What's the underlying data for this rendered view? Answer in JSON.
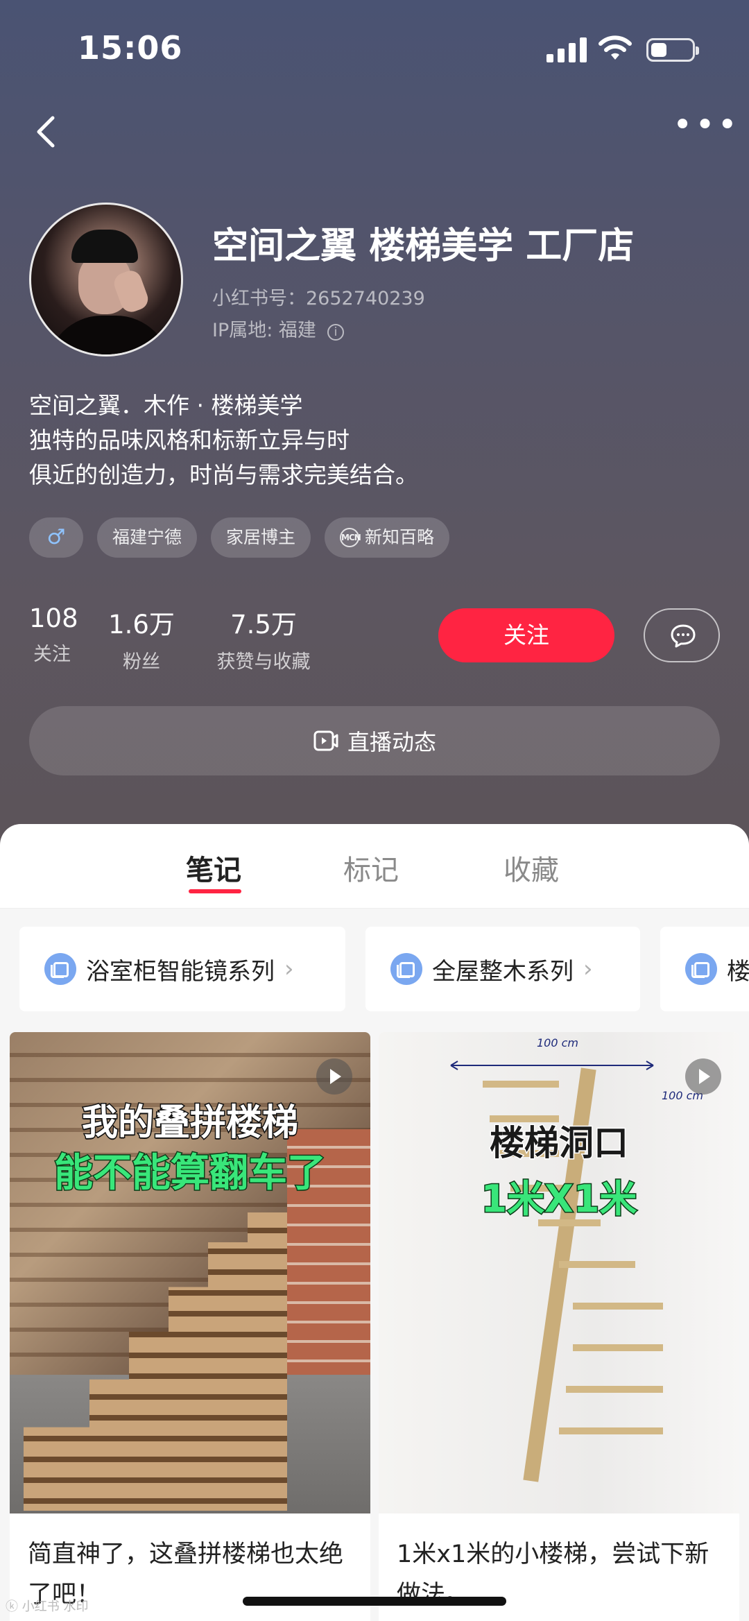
{
  "status_bar": {
    "time": "15:06"
  },
  "profile": {
    "name": "空间之翼 楼梯美学 工厂店",
    "id_label": "小红书号：2652740239",
    "ip_label": "IP属地: 福建",
    "bio_lines": [
      "空间之翼．木作 · 楼梯美学",
      "独特的品味风格和标新立异与时",
      "俱近的创造力，时尚与需求完美结合。"
    ],
    "tags": [
      {
        "icon": "male-icon",
        "label": "♂"
      },
      {
        "label": "福建宁德"
      },
      {
        "label": "家居博主"
      },
      {
        "icon": "mcn-icon",
        "icon_text": "MCN",
        "label": "新知百略"
      }
    ],
    "stats": [
      {
        "value": "108",
        "label": "关注"
      },
      {
        "value": "1.6万",
        "label": "粉丝"
      },
      {
        "value": "7.5万",
        "label": "获赞与收藏"
      }
    ],
    "follow_label": "关注",
    "live_label": "直播动态"
  },
  "tabs": [
    {
      "label": "笔记",
      "active": true
    },
    {
      "label": "标记",
      "active": false
    },
    {
      "label": "收藏",
      "active": false
    }
  ],
  "collections": [
    "浴室柜智能镜系列",
    "全屋整木系列",
    "楼"
  ],
  "notes": [
    {
      "overlay_line1": "我的叠拼楼梯",
      "overlay_line2": "能不能算翻车了",
      "title": "简直神了，这叠拼楼梯也太绝了吧！"
    },
    {
      "overlay_line1": "楼梯洞口",
      "overlay_line2": "1米X1米",
      "dimension_top": "100 cm",
      "dimension_side": "100 cm",
      "title": "1米x1米的小楼梯，尝试下新做法。"
    }
  ],
  "watermark": "ⓚ 小红书 水印",
  "colors": {
    "accent": "#ff2442",
    "header_bg": "#565568"
  }
}
